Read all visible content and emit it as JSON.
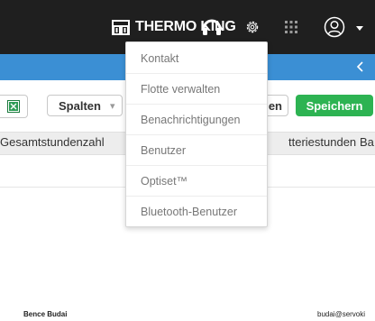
{
  "header": {
    "brand": "THERMO KING",
    "icons": [
      "thermo-king-logo-icon",
      "headset-icon",
      "gear-icon",
      "apps-grid-icon",
      "user-circle-icon",
      "caret-down-icon"
    ],
    "background": "#1f1f1f"
  },
  "subheader": {
    "color": "#3b8fd4",
    "icon": "chevron-left-icon"
  },
  "toolbar": {
    "excel_icon": "excel-icon",
    "columns_label": "Spalten",
    "hidden_button_label": "en",
    "save_label": "Speichern",
    "save_color": "#2db352"
  },
  "table": {
    "headers": [
      "Gesamtstundenzahl",
      "tteriestunden",
      "Ba"
    ]
  },
  "footer": {
    "name": "Bence Budai",
    "email": "budai@servoki"
  },
  "menu": {
    "items": [
      "Kontakt",
      "Flotte verwalten",
      "Benachrichtigungen",
      "Benutzer",
      "Optiset™",
      "Bluetooth-Benutzer"
    ]
  }
}
